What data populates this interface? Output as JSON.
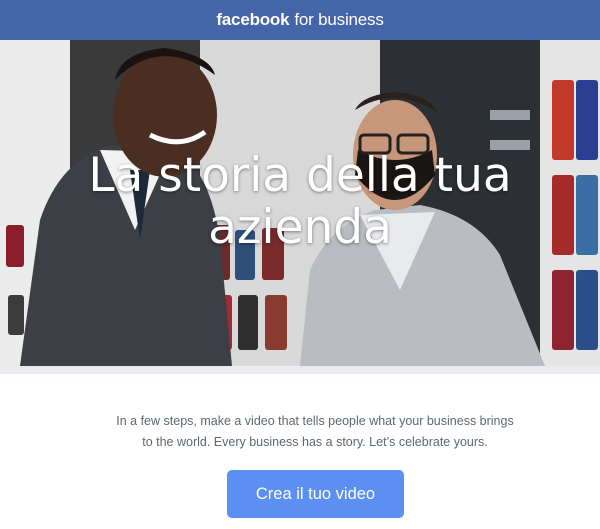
{
  "header": {
    "brand_primary": "facebook",
    "brand_suffix": "for business",
    "background_color": "#4466a8"
  },
  "hero": {
    "title_line1": "La storia della tua",
    "title_line2": "azienda",
    "image_alt": "two-men-talking-in-sock-store-photo"
  },
  "main": {
    "description": "In a few steps, make a video that tells people what your business brings to the world. Every business has a story. Let’s celebrate yours."
  },
  "cta": {
    "label": "Crea il tuo video",
    "color": "#5c8ff2"
  }
}
